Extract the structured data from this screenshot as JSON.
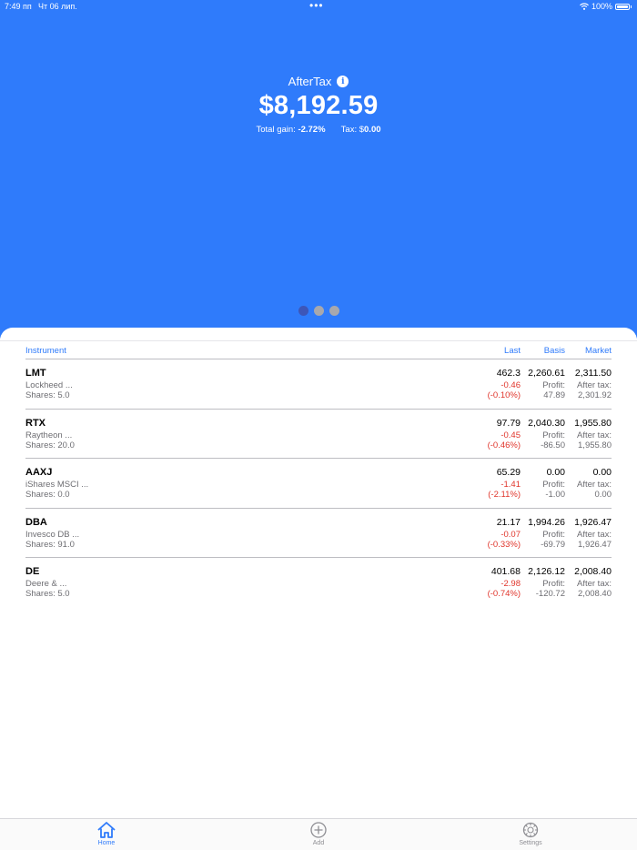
{
  "status": {
    "time": "7:49 пп",
    "date": "Чт 06 лип.",
    "dots": "•••",
    "battery": "100%"
  },
  "hero": {
    "title": "AfterTax",
    "value": "$8,192.59",
    "gain_label": "Total gain:",
    "gain_value": "-2.72%",
    "tax_label": "Tax: $",
    "tax_value": "0.00",
    "page_count": 3,
    "active_page": 0
  },
  "table": {
    "headers": {
      "instrument": "Instrument",
      "last": "Last",
      "basis": "Basis",
      "market": "Market"
    },
    "profit_label": "Profit:",
    "after_tax_label": "After tax:",
    "rows": [
      {
        "symbol": "LMT",
        "name": "Lockheed ...",
        "shares": "Shares: 5.0",
        "last": "462.3",
        "change": "-0.46",
        "pct": "(-0.10%)",
        "basis": "2,260.61",
        "profit": "47.89",
        "market": "2,311.50",
        "after_tax": "2,301.92"
      },
      {
        "symbol": "RTX",
        "name": "Raytheon ...",
        "shares": "Shares: 20.0",
        "last": "97.79",
        "change": "-0.45",
        "pct": "(-0.46%)",
        "basis": "2,040.30",
        "profit": "-86.50",
        "market": "1,955.80",
        "after_tax": "1,955.80"
      },
      {
        "symbol": "AAXJ",
        "name": "iShares MSCI ...",
        "shares": "Shares: 0.0",
        "last": "65.29",
        "change": "-1.41",
        "pct": "(-2.11%)",
        "basis": "0.00",
        "profit": "-1.00",
        "market": "0.00",
        "after_tax": "0.00"
      },
      {
        "symbol": "DBA",
        "name": "Invesco DB ...",
        "shares": "Shares: 91.0",
        "last": "21.17",
        "change": "-0.07",
        "pct": "(-0.33%)",
        "basis": "1,994.26",
        "profit": "-69.79",
        "market": "1,926.47",
        "after_tax": "1,926.47"
      },
      {
        "symbol": "DE",
        "name": "Deere & ...",
        "shares": "Shares: 5.0",
        "last": "401.68",
        "change": "-2.98",
        "pct": "(-0.74%)",
        "basis": "2,126.12",
        "profit": "-120.72",
        "market": "2,008.40",
        "after_tax": "2,008.40"
      }
    ]
  },
  "tabs": [
    {
      "label": "Home",
      "icon": "home-icon",
      "active": true
    },
    {
      "label": "Add",
      "icon": "add-circle-icon",
      "active": false
    },
    {
      "label": "Settings",
      "icon": "gear-icon",
      "active": false
    }
  ],
  "colors": {
    "accent": "#2f7bfb",
    "negative": "#e0352b",
    "muted": "#6d6d72"
  }
}
